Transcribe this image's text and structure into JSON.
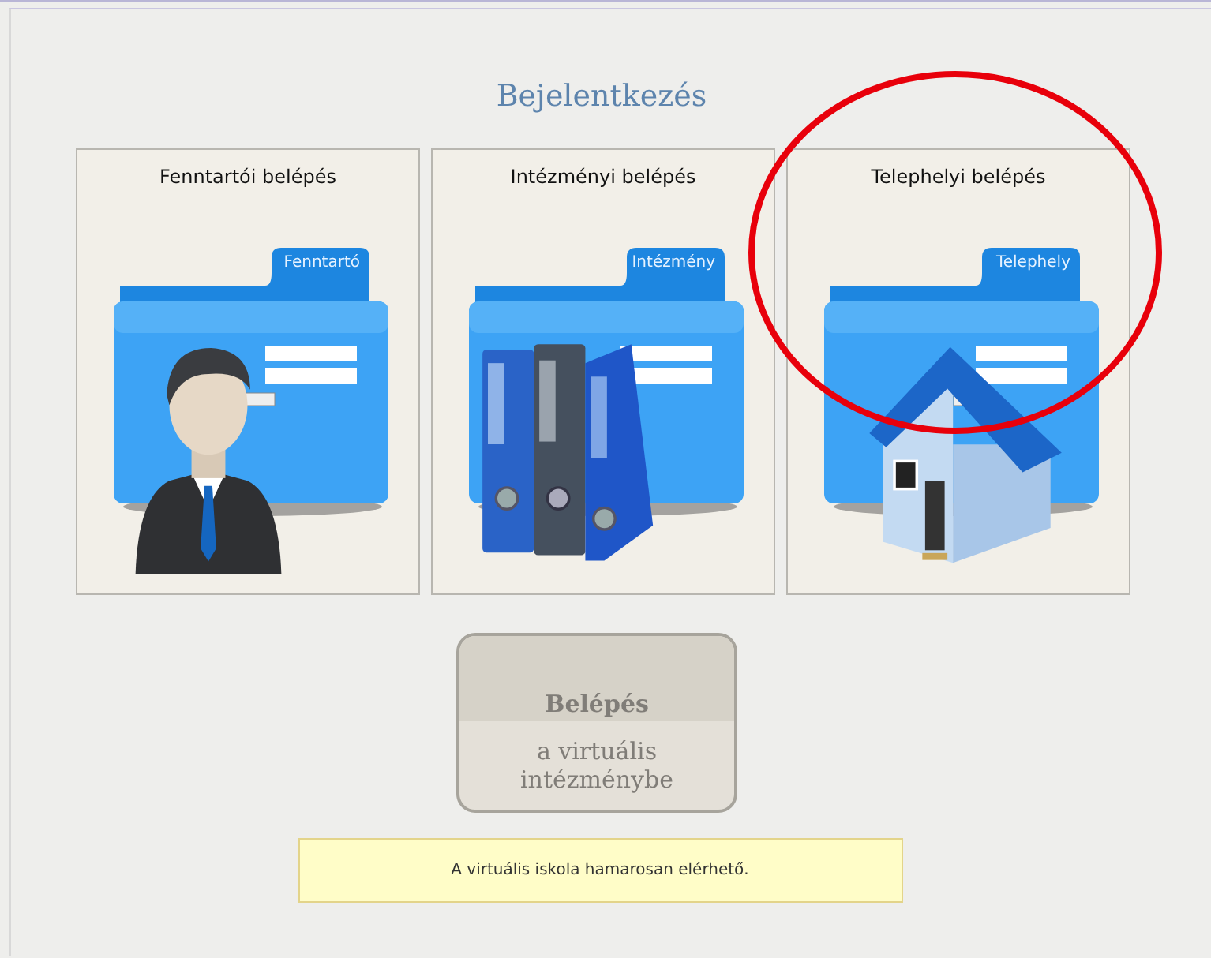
{
  "title": "Bejelentkezés",
  "cards": [
    {
      "title": "Fenntartói belépés",
      "tab": "Fenntartó",
      "kind": "person"
    },
    {
      "title": "Intézményi belépés",
      "tab": "Intézmény",
      "kind": "binders"
    },
    {
      "title": "Telephelyi belépés",
      "tab": "Telephely",
      "kind": "house"
    }
  ],
  "enter_button": {
    "label": "Belépés",
    "sublabel": "a virtuális intézménybe",
    "disabled": true
  },
  "notice": "A virtuális iskola hamarosan elérhető.",
  "annotation": {
    "kind": "ellipse",
    "color": "#e8000b"
  }
}
